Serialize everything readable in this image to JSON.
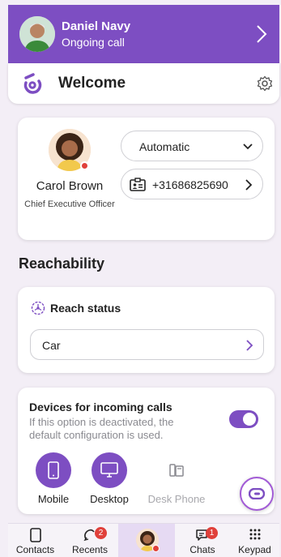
{
  "call_banner": {
    "name": "Daniel Navy",
    "status": "Ongoing call"
  },
  "header": {
    "title": "Welcome"
  },
  "profile": {
    "name": "Carol Brown",
    "role": "Chief Executive Officer",
    "availability": "Automatic",
    "phone_number": "+31686825690"
  },
  "reachability": {
    "section_title": "Reachability",
    "reach_status_label": "Reach status",
    "reach_status_value": "Car"
  },
  "devices": {
    "title": "Devices for incoming calls",
    "description": "If this option is deactivated, the default configuration is used.",
    "toggle_on": true,
    "items": [
      {
        "label": "Mobile",
        "active": true
      },
      {
        "label": "Desktop",
        "active": true
      },
      {
        "label": "Desk Phone",
        "active": false
      }
    ]
  },
  "bottom_nav": {
    "items": [
      {
        "label": "Contacts",
        "icon": "contacts-icon"
      },
      {
        "label": "Recents",
        "icon": "recents-icon",
        "badge": "2"
      },
      {
        "label": "",
        "icon": "avatar"
      },
      {
        "label": "Chats",
        "icon": "chats-icon",
        "badge": "1"
      },
      {
        "label": "Keypad",
        "icon": "keypad-icon"
      }
    ]
  },
  "colors": {
    "accent": "#7d4ec2",
    "alert": "#e0403a"
  }
}
